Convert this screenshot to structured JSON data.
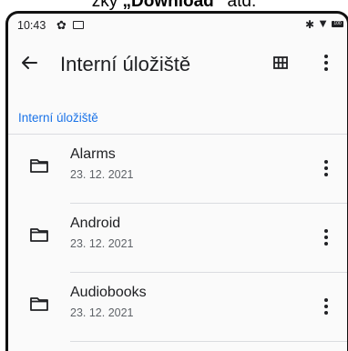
{
  "caption": {
    "prefix": "zky ",
    "quoted": "„Download“",
    "suffix": " atd."
  },
  "statusbar": {
    "time": "10:43",
    "battery_label": "100"
  },
  "appbar": {
    "title": "Interní úložiště"
  },
  "breadcrumb": {
    "label": "Interní úložiště"
  },
  "files": [
    {
      "name": "Alarms",
      "date": "23. 12. 2021"
    },
    {
      "name": "Android",
      "date": "23. 12. 2021"
    },
    {
      "name": "Audiobooks",
      "date": "23. 12. 2021"
    }
  ],
  "colors": {
    "accent": "#1a73e8",
    "text_primary": "#202124",
    "text_secondary": "#5f6368",
    "divider": "#dadce0",
    "background": "#fafafa"
  },
  "icons": {
    "back": "arrow-back-icon",
    "view": "grid-view-icon",
    "menu": "more-vert-icon",
    "folder": "folder-icon"
  }
}
